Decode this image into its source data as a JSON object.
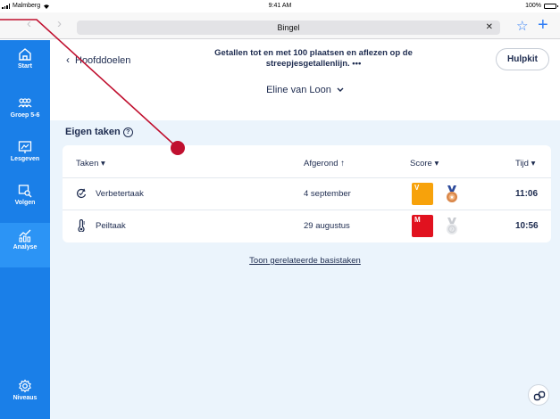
{
  "status": {
    "carrier": "Malmberg",
    "time": "9:41 AM",
    "battery": "100%",
    "battery_level": 1.0
  },
  "browser": {
    "url_text": "Bingel",
    "clear_icon": "close-icon",
    "bookmark_icon": "star-icon",
    "new_tab_icon": "plus-icon"
  },
  "sidebar": {
    "items": [
      {
        "label": "Start",
        "icon": "home-icon"
      },
      {
        "label": "Groep 5-6",
        "icon": "group-icon"
      },
      {
        "label": "Lesgeven",
        "icon": "presentation-icon"
      },
      {
        "label": "Volgen",
        "icon": "monitor-search-icon"
      },
      {
        "label": "Analyse",
        "icon": "analytics-icon",
        "active": true
      },
      {
        "label": "Niveaus",
        "icon": "gear-icon"
      }
    ]
  },
  "header": {
    "back_label": "Hoofddoelen",
    "title": "Getallen tot en met 100 plaatsen en aflezen op de streepjesgetallenlijn. •••",
    "hulpkit_label": "Hulpkit",
    "student": "Eline van Loon"
  },
  "section": {
    "title": "Eigen taken"
  },
  "table": {
    "columns": {
      "taken": "Taken",
      "afgerond": "Afgerond",
      "score": "Score",
      "tijd": "Tijd"
    },
    "rows": [
      {
        "name": "Verbetertaak",
        "icon": "redo-task-icon",
        "afgerond": "4 september",
        "score_letter": "V",
        "score_color": "#f7a20b",
        "medal": "bronze-medal-icon",
        "tijd": "11:06"
      },
      {
        "name": "Peiltaak",
        "icon": "thermometer-icon",
        "afgerond": "29 augustus",
        "score_letter": "M",
        "score_color": "#e1121f",
        "medal": "empty-medal-icon",
        "tijd": "10:56"
      }
    ]
  },
  "related_link": "Toon gerelateerde basistaken",
  "colors": {
    "sidebar": "#1a7fe8",
    "sidebar_active": "#2c94f5",
    "content_bg": "#ebf4fc",
    "text": "#1d2b4f",
    "annotation": "#c0102f"
  }
}
